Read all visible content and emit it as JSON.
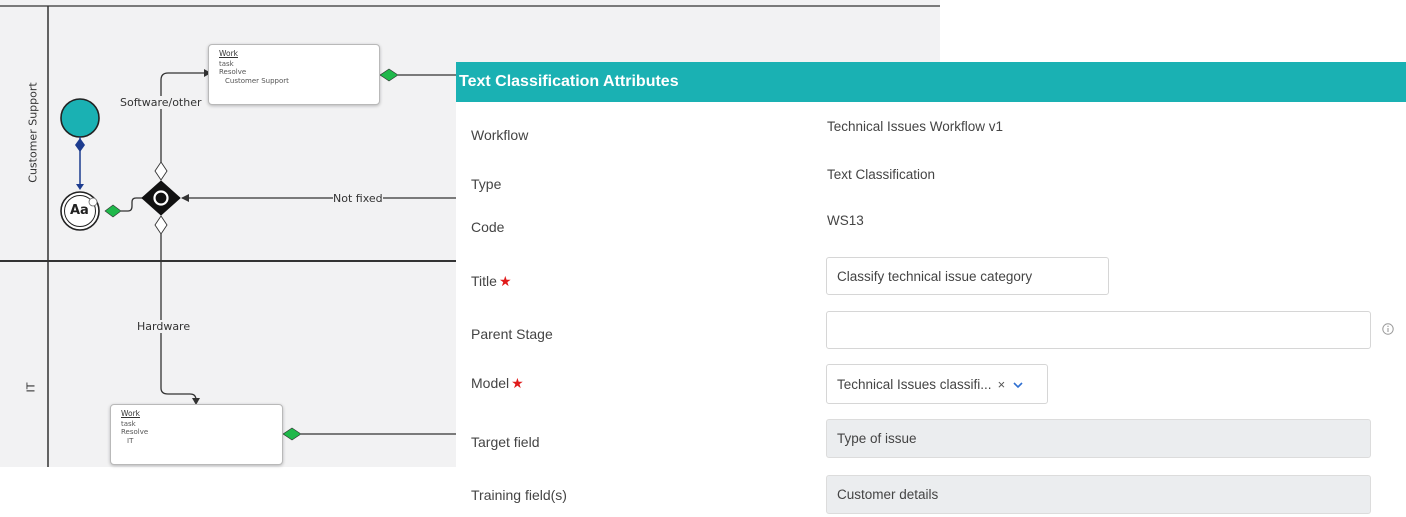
{
  "diagram": {
    "lanes": [
      {
        "label": "Customer Support"
      },
      {
        "label": "IT"
      }
    ],
    "tasks": [
      {
        "title": "Work",
        "lines": [
          "task",
          "Resolve"
        ],
        "lane": "Customer Support"
      },
      {
        "title": "Work",
        "lines": [
          "task",
          "Resolve"
        ],
        "lane": "IT"
      }
    ],
    "flow_labels": {
      "software": "Software/other",
      "not_fixed": "Not fixed",
      "hardware": "Hardware"
    },
    "classifier_node_text": "Aa",
    "colors": {
      "start_event": "#1ab1b3",
      "connector_green": "#1fb84a",
      "connector_blue": "#1d3c8f"
    }
  },
  "panel": {
    "title": "Text Classification Attributes",
    "header_color": "#1ab1b3",
    "workflow": {
      "label": "Workflow",
      "value": "Technical Issues Workflow v1"
    },
    "type": {
      "label": "Type",
      "value": "Text Classification"
    },
    "code": {
      "label": "Code",
      "value": "WS13"
    },
    "title_field": {
      "label": "Title",
      "value": "Classify technical issue category",
      "required": true
    },
    "parent_stage": {
      "label": "Parent Stage",
      "value": ""
    },
    "model": {
      "label": "Model",
      "value": "Technical Issues classifi...",
      "required": true
    },
    "target_field": {
      "label": "Target field",
      "value": "Type of issue"
    },
    "training_fields": {
      "label": "Training field(s)",
      "value": "Customer details"
    },
    "required_marker": "★",
    "clear_glyph": "×"
  }
}
